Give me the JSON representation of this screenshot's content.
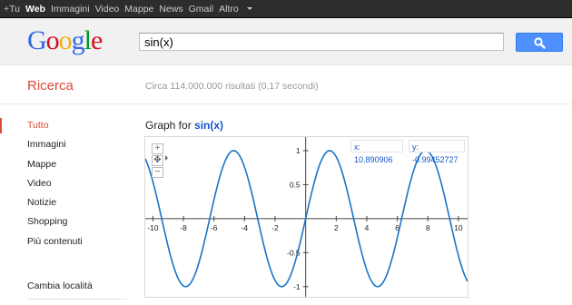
{
  "topbar": {
    "links": [
      {
        "label": "+Tu",
        "active": false
      },
      {
        "label": "Web",
        "active": true
      },
      {
        "label": "Immagini",
        "active": false
      },
      {
        "label": "Video",
        "active": false
      },
      {
        "label": "Mappe",
        "active": false
      },
      {
        "label": "News",
        "active": false
      },
      {
        "label": "Gmail",
        "active": false
      },
      {
        "label": "Altro",
        "active": false
      }
    ]
  },
  "header": {
    "logo": "Google",
    "query": "sin(x)",
    "search_icon": "magnifier-icon",
    "colors": {
      "blue": "#3369e8",
      "red": "#d50f25",
      "yellow": "#eeb211",
      "green": "#009925"
    }
  },
  "results": {
    "section_label": "Ricerca",
    "stats": "Circa 114.000.000 risultati (0,17 secondi)"
  },
  "leftnav": {
    "items": [
      "Tutto",
      "Immagini",
      "Mappe",
      "Video",
      "Notizie",
      "Shopping",
      "Più contenuti"
    ],
    "selected": "Tutto",
    "location_label": "Cambia località"
  },
  "graph": {
    "title_prefix": "Graph for",
    "title_query": "sin(x)",
    "x_readout": "x: 10.890906",
    "y_readout": "y: -0.99452727",
    "zoom_in": "+",
    "zoom_out": "−"
  },
  "chart_data": {
    "type": "line",
    "function": "sin(x)",
    "series": [
      {
        "name": "sin(x)",
        "color": "#1a73c9"
      }
    ],
    "xlim": [
      -10.5,
      10.6
    ],
    "ylim": [
      -1.15,
      1.2
    ],
    "x_ticks": [
      -10,
      -8,
      -6,
      -4,
      -2,
      2,
      4,
      6,
      8,
      10
    ],
    "y_ticks": [
      1,
      0.5,
      -0.5,
      -1
    ],
    "grid": false
  }
}
